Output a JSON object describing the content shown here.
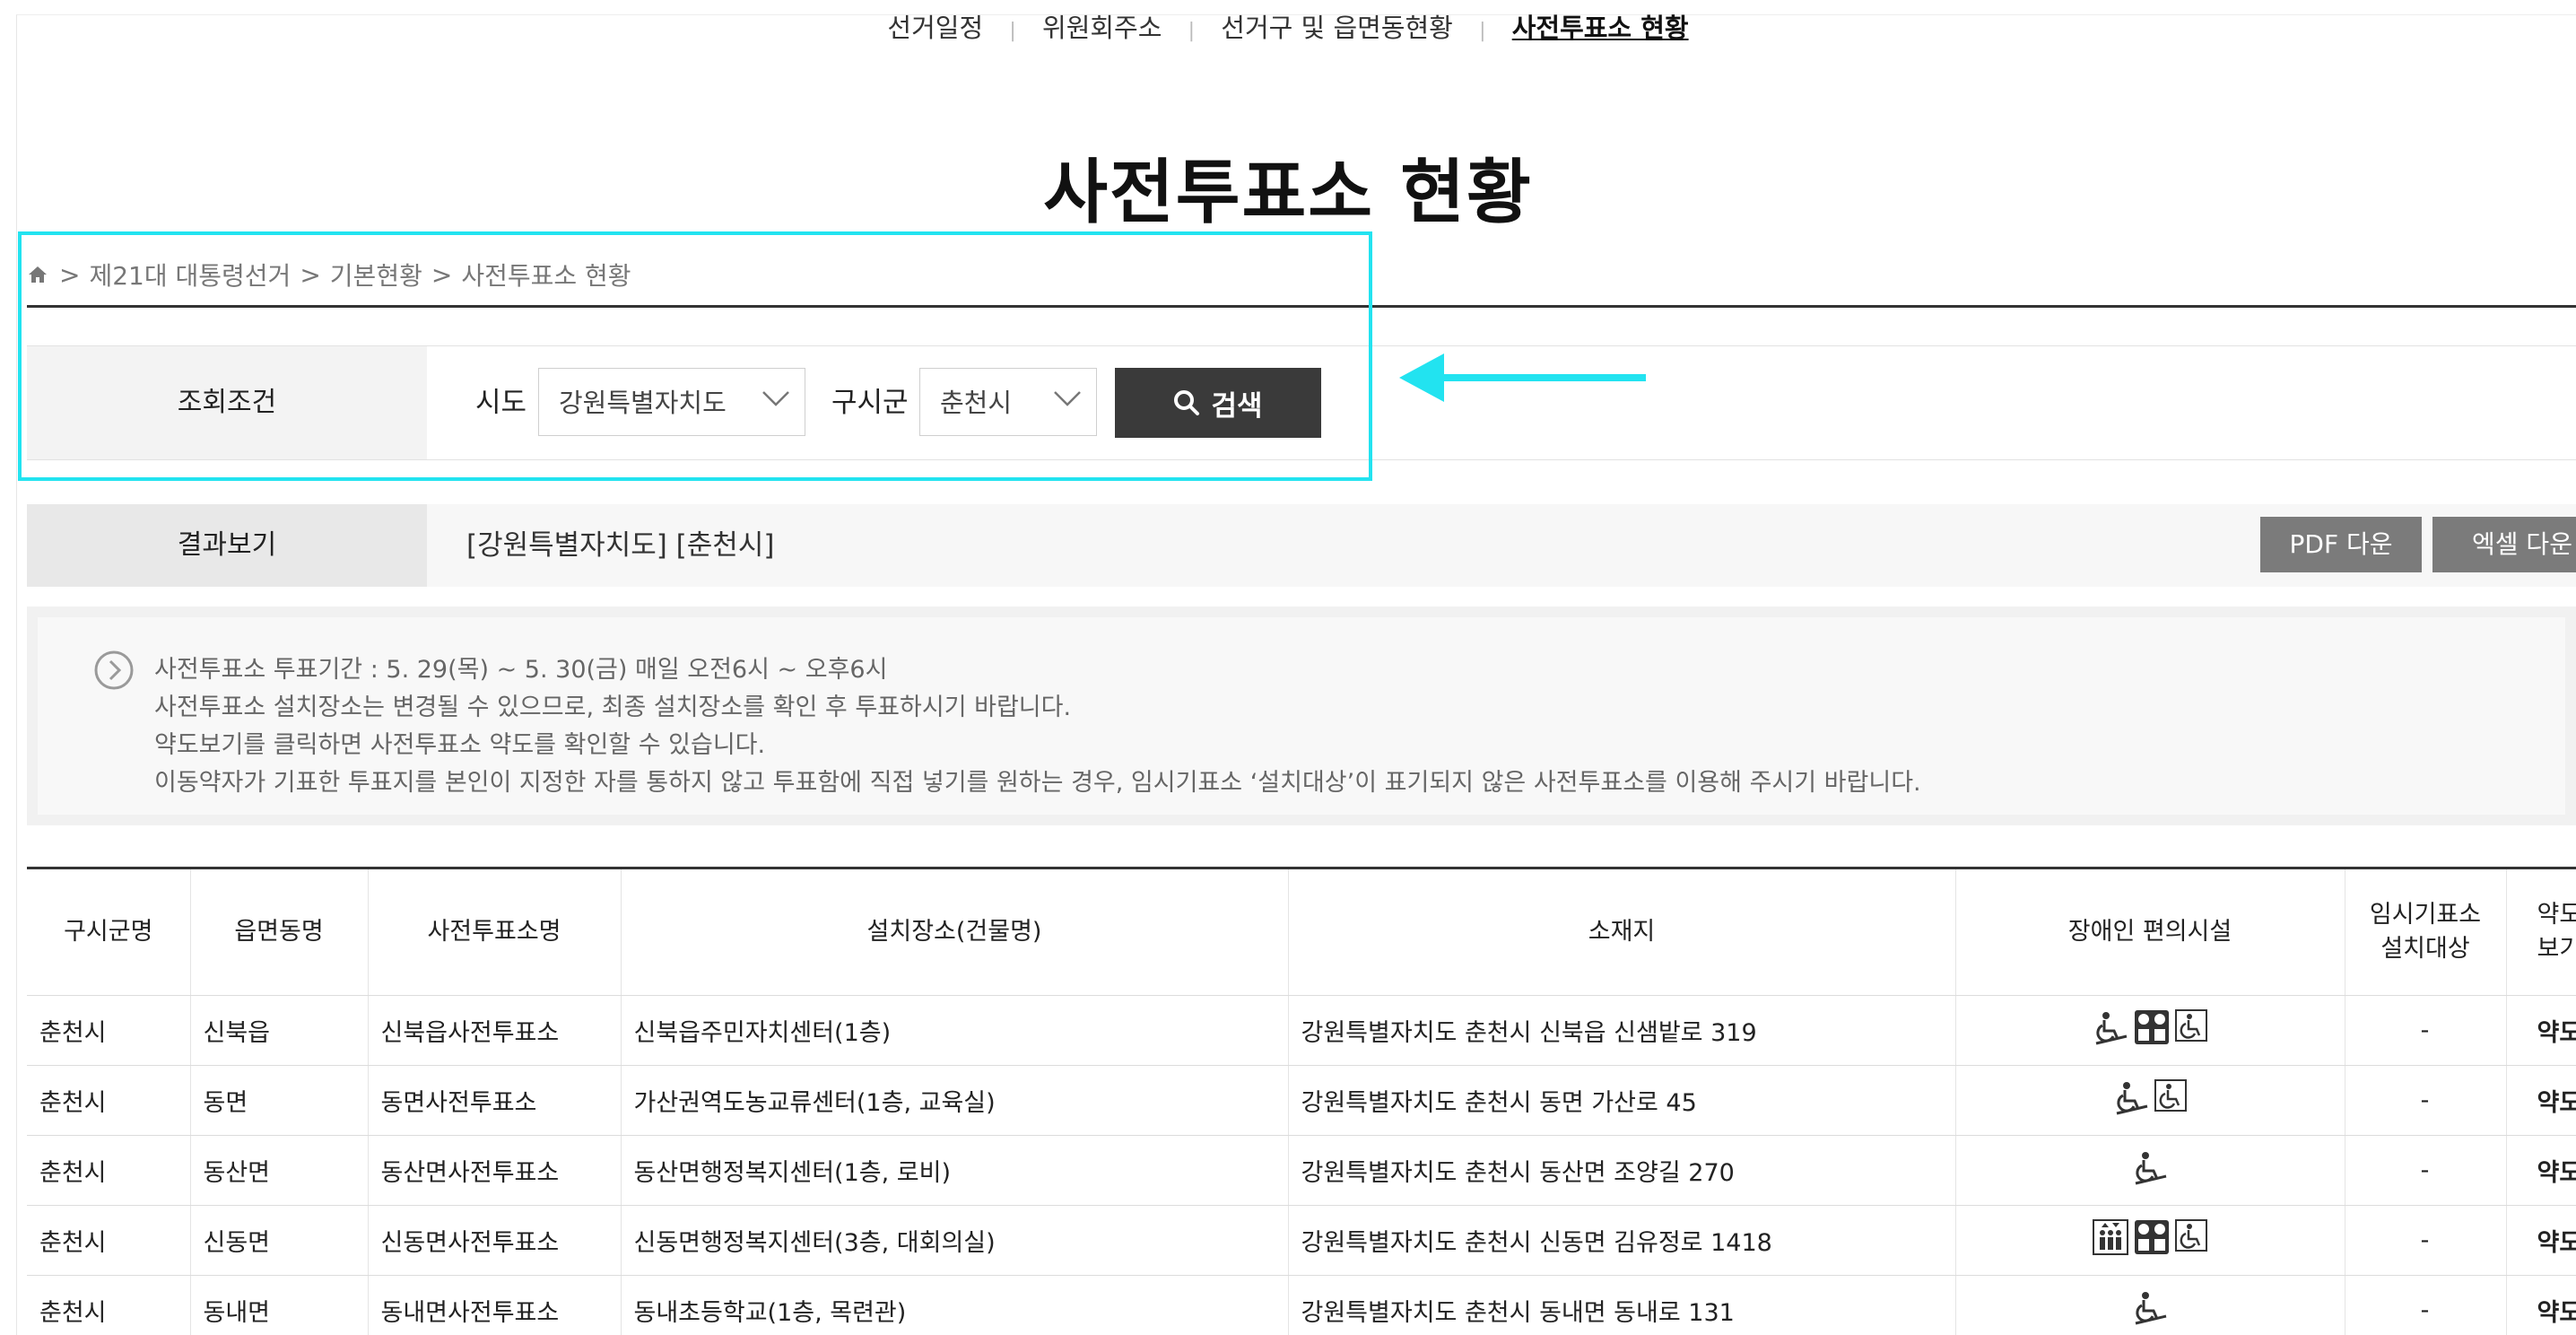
{
  "nav": {
    "items": [
      "선거일정",
      "위원회주소",
      "선거구 및 읍면동현황",
      "사전투표소 현황"
    ],
    "active_index": 3,
    "separator": "|"
  },
  "page_title": "사전투표소 현황",
  "breadcrumb": [
    "제21대 대통령선거",
    "기본현황",
    "사전투표소 현황"
  ],
  "breadcrumb_sep": ">",
  "search": {
    "label": "조회조건",
    "sido_label": "시도",
    "sido_value": "강원특별자치도",
    "sigungu_label": "구시군",
    "sigungu_value": "춘천시",
    "button_label": "검색"
  },
  "result": {
    "label": "결과보기",
    "value": "[강원특별자치도] [춘천시]",
    "pdf_label": "PDF 다운",
    "excel_label": "엑셀 다운"
  },
  "notice": [
    "사전투표소 투표기간 : 5. 29(목) ~ 5. 30(금) 매일 오전6시 ~ 오후6시",
    "사전투표소 설치장소는 변경될 수 있으므로, 최종 설치장소를 확인 후 투표하시기 바랍니다.",
    "약도보기를 클릭하면 사전투표소 약도를 확인할 수 있습니다.",
    "이동약자가 기표한 투표지를 본인이 지정한 자를 통하지 않고 투표함에 직접 넣기를 원하는 경우, 임시기표소 ‘설치대상’이 표기되지 않은 사전투표소를 이용해 주시기 바랍니다."
  ],
  "table": {
    "headers": [
      "구시군명",
      "읍면동명",
      "사전투표소명",
      "설치장소(건물명)",
      "소재지",
      "장애인 편의시설",
      "임시기표소\n설치대상",
      "약도\n보기"
    ],
    "rows": [
      {
        "sigungu": "춘천시",
        "eup": "신북읍",
        "name": "신북읍사전투표소",
        "place": "신북읍주민자치센터(1층)",
        "addr": "강원특별자치도 춘천시 신북읍 신샘밭로 319",
        "icons": [
          "wheelchair-ramp",
          "elevator",
          "wheelchair"
        ],
        "temp": "-",
        "map": "약도"
      },
      {
        "sigungu": "춘천시",
        "eup": "동면",
        "name": "동면사전투표소",
        "place": "가산권역도농교류센터(1층, 교육실)",
        "addr": "강원특별자치도 춘천시 동면 가산로 45",
        "icons": [
          "wheelchair-ramp",
          "wheelchair"
        ],
        "temp": "-",
        "map": "약도"
      },
      {
        "sigungu": "춘천시",
        "eup": "동산면",
        "name": "동산면사전투표소",
        "place": "동산면행정복지센터(1층, 로비)",
        "addr": "강원특별자치도 춘천시 동산면 조양길 270",
        "icons": [
          "wheelchair-ramp"
        ],
        "temp": "-",
        "map": "약도"
      },
      {
        "sigungu": "춘천시",
        "eup": "신동면",
        "name": "신동면사전투표소",
        "place": "신동면행정복지센터(3층, 대회의실)",
        "addr": "강원특별자치도 춘천시 신동면 김유정로 1418",
        "icons": [
          "lift",
          "elevator",
          "wheelchair"
        ],
        "temp": "-",
        "map": "약도"
      },
      {
        "sigungu": "춘천시",
        "eup": "동내면",
        "name": "동내면사전투표소",
        "place": "동내초등학교(1층, 목련관)",
        "addr": "강원특별자치도 춘천시 동내면 동내로 131",
        "icons": [
          "wheelchair-ramp"
        ],
        "temp": "-",
        "map": "약도"
      }
    ]
  },
  "colors": {
    "annotation": "#22e3f0",
    "search_button": "#3a3a3a",
    "download_button": "#7b7b7b"
  }
}
